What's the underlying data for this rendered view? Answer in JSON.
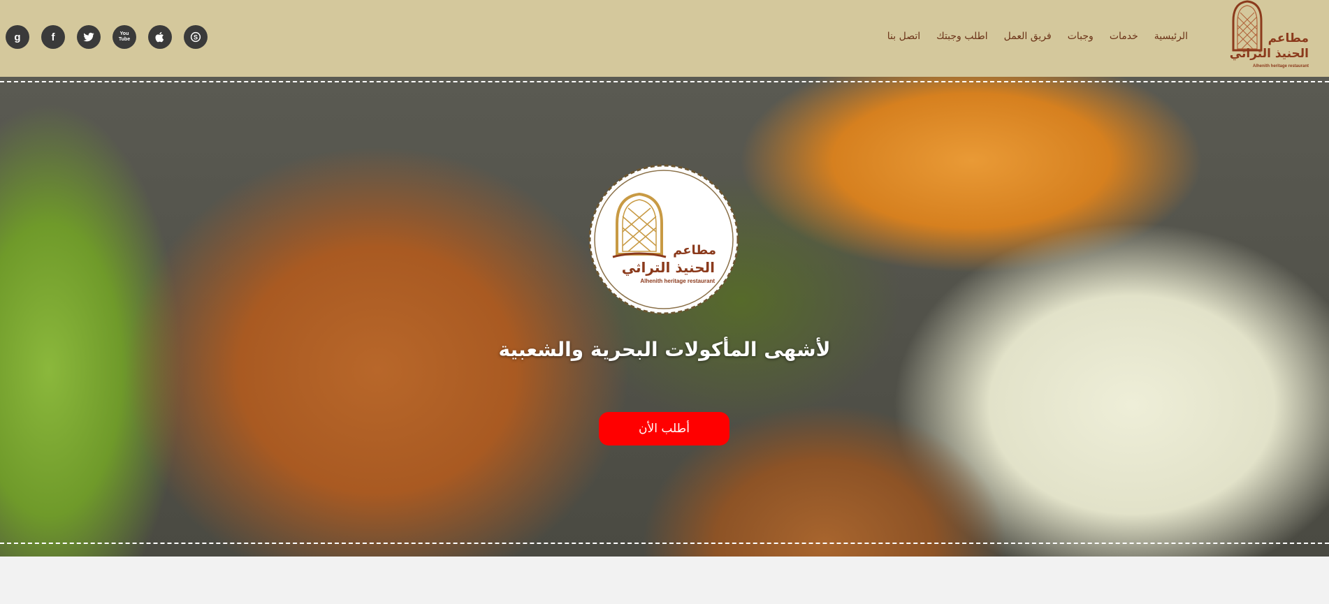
{
  "header": {
    "nav": [
      {
        "label": "الرئيسية"
      },
      {
        "label": "خدمات"
      },
      {
        "label": "وجبات"
      },
      {
        "label": "فريق العمل"
      },
      {
        "label": "اطلب وجبتك"
      },
      {
        "label": "اتصل بنا"
      }
    ],
    "social": [
      {
        "icon": "google-plus-icon",
        "glyph": "g"
      },
      {
        "icon": "facebook-icon",
        "glyph": "f"
      },
      {
        "icon": "twitter-icon",
        "glyph": ""
      },
      {
        "icon": "youtube-icon",
        "glyph": "You Tube"
      },
      {
        "icon": "apple-icon",
        "glyph": ""
      },
      {
        "icon": "skype-icon",
        "glyph": "S"
      }
    ],
    "logo": {
      "line1": "مطاعم",
      "line2": "الحنيذ التراثي",
      "english": "Alhenith heritage restaurant"
    }
  },
  "hero": {
    "tagline": "لأشهى المأكولات البحرية والشعبية",
    "cta_label": "أطلب الأن",
    "emblem": {
      "line1": "مطاعم",
      "line2": "الحنيذ التراثي",
      "english": "Alhenith heritage restaurant"
    }
  },
  "colors": {
    "header_bg": "#d4c89c",
    "nav_text": "#6b3318",
    "cta_bg": "#ff0000",
    "logo_brown": "#8b3a1c",
    "logo_gold": "#c89a44"
  }
}
